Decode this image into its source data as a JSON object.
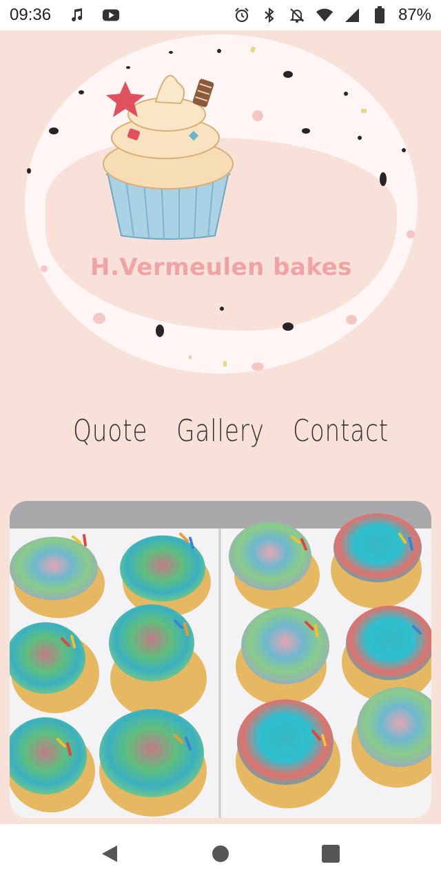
{
  "status_bar": {
    "time": "09:36",
    "left_icons": [
      "music-note-icon",
      "youtube-icon"
    ],
    "right_icons": [
      "alarm-icon",
      "bluetooth-icon",
      "notifications-off-icon",
      "wifi-icon",
      "cell-signal-icon",
      "battery-icon"
    ],
    "battery_percent": "87%"
  },
  "logo": {
    "title": "H.Vermeulen bakes",
    "title_color": "#f0a3a7"
  },
  "nav": {
    "items": [
      {
        "label": "Quote"
      },
      {
        "label": "Gallery"
      },
      {
        "label": "Contact"
      }
    ]
  },
  "gallery": {
    "image_subject": "cupcakes-photo"
  },
  "system_nav": {
    "icons": [
      "back-icon",
      "home-icon",
      "recents-icon"
    ]
  },
  "colors": {
    "page_background": "#f8e1d9",
    "bar_background": "#ffffff",
    "nav_text": "#333333"
  }
}
